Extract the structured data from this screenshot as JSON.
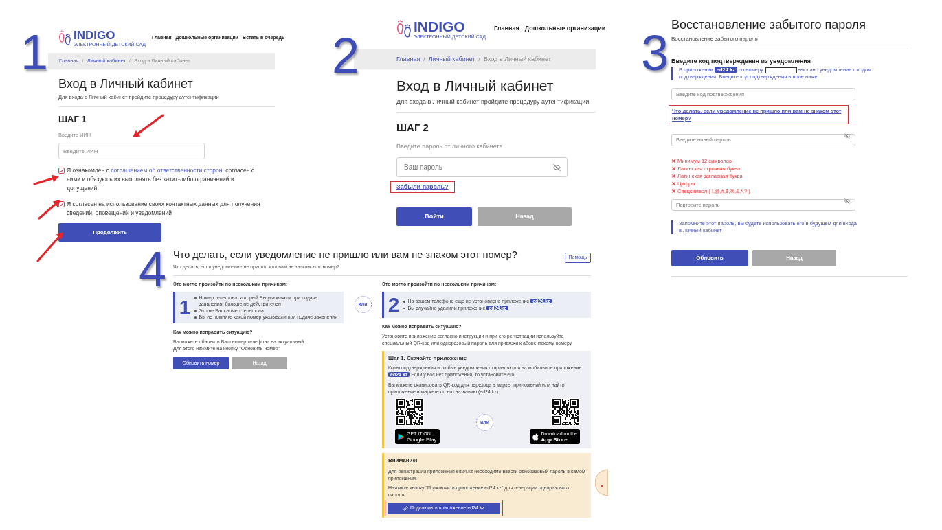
{
  "screen_1": {
    "step_number": "1",
    "logo": {
      "name": "INDIGO",
      "tagline": "ЭЛЕКТРОННЫЙ ДЕТСКИЙ САД"
    },
    "nav": [
      "Главная",
      "Дошкольные организации",
      "Встать в очередь"
    ],
    "breadcrumbs": [
      {
        "kind": "link",
        "label": "Главная"
      },
      {
        "kind": "separator",
        "label": "/"
      },
      {
        "kind": "link",
        "label": "Личный кабинет"
      },
      {
        "kind": "separator",
        "label": "/"
      },
      {
        "kind": "current",
        "label": "Вход в Личный кабинет"
      }
    ],
    "title": "Вход в Личный кабинет",
    "subtitle": "Для входа в Личный кабинет пройдите процедуру аутентификации",
    "step_title": "ШАГ 1",
    "field": {
      "label": "Введите ИИН",
      "placeholder": "Введите ИИН"
    },
    "agreements": [
      {
        "checked": true,
        "parts": [
          {
            "kind": "text",
            "text": "Я ознакомлен с "
          },
          {
            "kind": "link",
            "text": "соглашением об ответственности сторон"
          },
          {
            "kind": "text",
            "text": ", согласен с ними и обязуюсь их выполнять без каких-либо ограничений и допущений"
          }
        ]
      },
      {
        "checked": true,
        "parts": [
          {
            "kind": "text",
            "text": "Я согласен на использование своих контактных данных для получения сведений, оповещений и уведомлений"
          }
        ]
      }
    ],
    "button": {
      "label": "Продолжить",
      "kind": "primary"
    }
  },
  "screen_2": {
    "step_number": "2",
    "logo": {
      "name": "INDIGO",
      "tagline": "ЭЛЕКТРОННЫЙ ДЕТСКИЙ САД"
    },
    "nav": [
      "Главная",
      "Дошкольные организации"
    ],
    "breadcrumbs": [
      {
        "kind": "link",
        "label": "Главная"
      },
      {
        "kind": "separator",
        "label": "/"
      },
      {
        "kind": "link",
        "label": "Личный кабинет"
      },
      {
        "kind": "separator",
        "label": "/"
      },
      {
        "kind": "current",
        "label": "Вход в Личный кабинет"
      }
    ],
    "title": "Вход в Личный кабинет",
    "subtitle": "Для входа в Личный кабинет пройдите процедуру аутентификации",
    "step_title": "ШАГ 2",
    "field": {
      "label": "Введите пароль от личного кабинета",
      "placeholder": "Ваш пароль"
    },
    "forgot_link": {
      "label": "Забыли пароль?",
      "highlighted": true
    },
    "buttons": [
      {
        "label": "Войти",
        "kind": "primary"
      },
      {
        "label": "Назад",
        "kind": "secondary"
      }
    ]
  },
  "screen_3": {
    "step_number": "3",
    "title": "Восстановление забытого пароля",
    "subtitle": "Восстановление забытого пароля",
    "section_title": "Введите код подтверждения из уведомления",
    "notice_parts": [
      {
        "kind": "text",
        "text": "В приложении "
      },
      {
        "kind": "badge",
        "text": "ed24.kz"
      },
      {
        "kind": "text",
        "text": " по номеру "
      },
      {
        "kind": "redacted"
      },
      {
        "kind": "text",
        "text": "выслано уведомление с кодом подтверждения. Введите код подтверждения в поле ниже"
      }
    ],
    "code_field": {
      "placeholder": "Введите код подтверждения"
    },
    "help_link": {
      "label": "Что делать, если уведомление не пришло или вам не знаком этот номер?",
      "highlighted": true
    },
    "new_password_field": {
      "placeholder": "Введите новый пароль"
    },
    "requirements": [
      {
        "label": "Минимум 12 символов",
        "met": false
      },
      {
        "label": "Латинская строчная буква",
        "met": false
      },
      {
        "label": "Латинская заглавная буква",
        "met": false
      },
      {
        "label": "Цифры",
        "met": false
      },
      {
        "label": "Спецсимвол ( !,@,#,$,%,&,*,? )",
        "met": false
      }
    ],
    "repeat_password_field": {
      "placeholder": "Повторите пароль"
    },
    "reminder": "Запомните этот пароль, вы будете использовать его в будущем для входа в Личный кабинет",
    "buttons": [
      {
        "label": "Обновить",
        "kind": "primary"
      },
      {
        "label": "Назад",
        "kind": "secondary"
      }
    ]
  },
  "screen_4": {
    "step_number": "4",
    "title": "Что делать, если уведомление не пришло или вам не знаком этот номер?",
    "help_button": "Помощь",
    "subtitle": "Что делать, если уведомление не пришло или вам не знаком этот номер?",
    "separator": "или",
    "cases": [
      {
        "intro": "Это могло произойти по нескольким причинам:",
        "number": "1",
        "reasons": [
          {
            "parts": [
              {
                "kind": "text",
                "text": "Номер телефона, который Вы указывали при подаче заявления, больше не действителен"
              }
            ]
          },
          {
            "parts": [
              {
                "kind": "text",
                "text": "Это не Ваш номер телефона"
              }
            ]
          },
          {
            "parts": [
              {
                "kind": "text",
                "text": "Вы не помните какой номер указывали при подаче заявления"
              }
            ]
          }
        ],
        "fix_title": "Как можно исправить ситуацию?",
        "fix_text": [
          "Вы можете обновить Ваш номер телефона на актуальный.",
          "Для этого нажмите на кнопку \"Обновить номер\""
        ],
        "buttons": [
          {
            "label": "Обновить номер",
            "kind": "primary"
          },
          {
            "label": "Назад",
            "kind": "secondary"
          }
        ]
      },
      {
        "intro": "Это могло произойти по нескольким причинам:",
        "number": "2",
        "reasons": [
          {
            "parts": [
              {
                "kind": "text",
                "text": "На вашем телефоне еще не установлено приложение "
              },
              {
                "kind": "badge",
                "text": "ed24.kz"
              }
            ]
          },
          {
            "parts": [
              {
                "kind": "text",
                "text": "Вы случайно удалили приложение "
              },
              {
                "kind": "badge",
                "text": "ed24.kz"
              }
            ]
          }
        ],
        "fix_title": "Как можно исправить ситуацию?",
        "fix_text": [
          "Установите приложение согласно инструкции и при его регистрации используйте специальный QR-код или одноразовый пароль для привязки к абонентскому номеру"
        ],
        "step": {
          "title": "Шаг 1. Скачайте приложение",
          "text_parts": [
            {
              "kind": "text",
              "text": "Коды подтверждения и любые уведомления отправляются на мобильное приложение "
            },
            {
              "kind": "badge",
              "text": "ed24.kz"
            },
            {
              "kind": "text",
              "text": " Если у вас нет приложения, то установите его"
            }
          ],
          "scan_text": "Вы можете сканировать QR-код для перехода в маркет приложений или найти приложение в маркете по его названию (ed24.kz)",
          "separator": "или",
          "stores": [
            {
              "kind": "google_play",
              "small": "GET IT ON",
              "name": "Google Play"
            },
            {
              "kind": "app_store",
              "small": "Download on the",
              "name": "App Store"
            }
          ]
        },
        "warning": {
          "title": "Внимание!",
          "paragraphs": [
            "Для регистрации приложения ed24.kz необходимо ввести одноразовый пароль в самом приложении",
            "Нажмите кнопку \"Подключить приложение ed24.kz\" для генерации одноразового пароля"
          ],
          "button": {
            "label": "Подключить приложение ed24.kz",
            "highlighted": true
          }
        }
      }
    ]
  }
}
